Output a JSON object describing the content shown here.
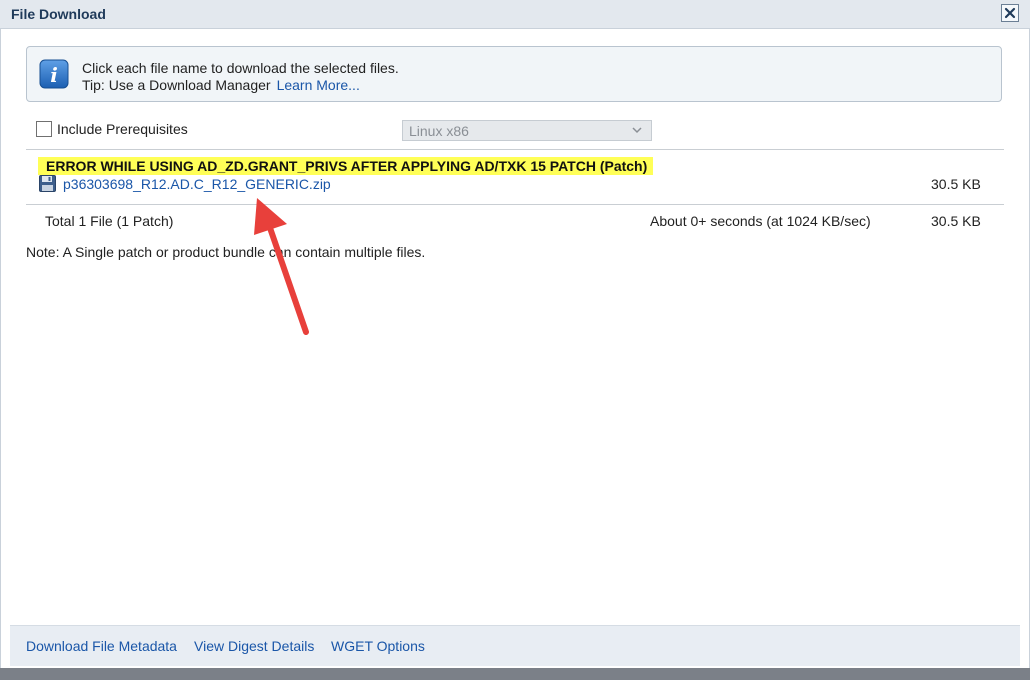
{
  "window": {
    "title": "File Download"
  },
  "info": {
    "line1": "Click each file name to download the selected files.",
    "tip": "Tip: Use a Download Manager",
    "learn_more": "Learn More..."
  },
  "prereq": {
    "label": "Include Prerequisites"
  },
  "platform": {
    "selected": "Linux x86"
  },
  "patch": {
    "title": "ERROR WHILE USING AD_ZD.GRANT_PRIVS AFTER APPLYING AD/TXK 15 PATCH (Patch)",
    "file": {
      "name": "p36303698_R12.AD.C_R12_GENERIC.zip",
      "size": "30.5 KB"
    }
  },
  "summary": {
    "total": "Total 1 File (1 Patch)",
    "eta": "About 0+ seconds (at 1024 KB/sec)",
    "size": "30.5 KB"
  },
  "note": "Note: A Single patch or product bundle can contain multiple files.",
  "footer": {
    "metadata": "Download File Metadata",
    "digest": "View Digest Details",
    "wget": "WGET Options"
  },
  "colors": {
    "link": "#1a56a8",
    "highlight": "#ffff57",
    "arrow": "#e8403b"
  },
  "icons": {
    "close": "close-icon",
    "info": "info-icon",
    "file": "floppy-disk-icon",
    "dropdown": "chevron-down-icon",
    "annotation": "red-arrow-icon"
  }
}
